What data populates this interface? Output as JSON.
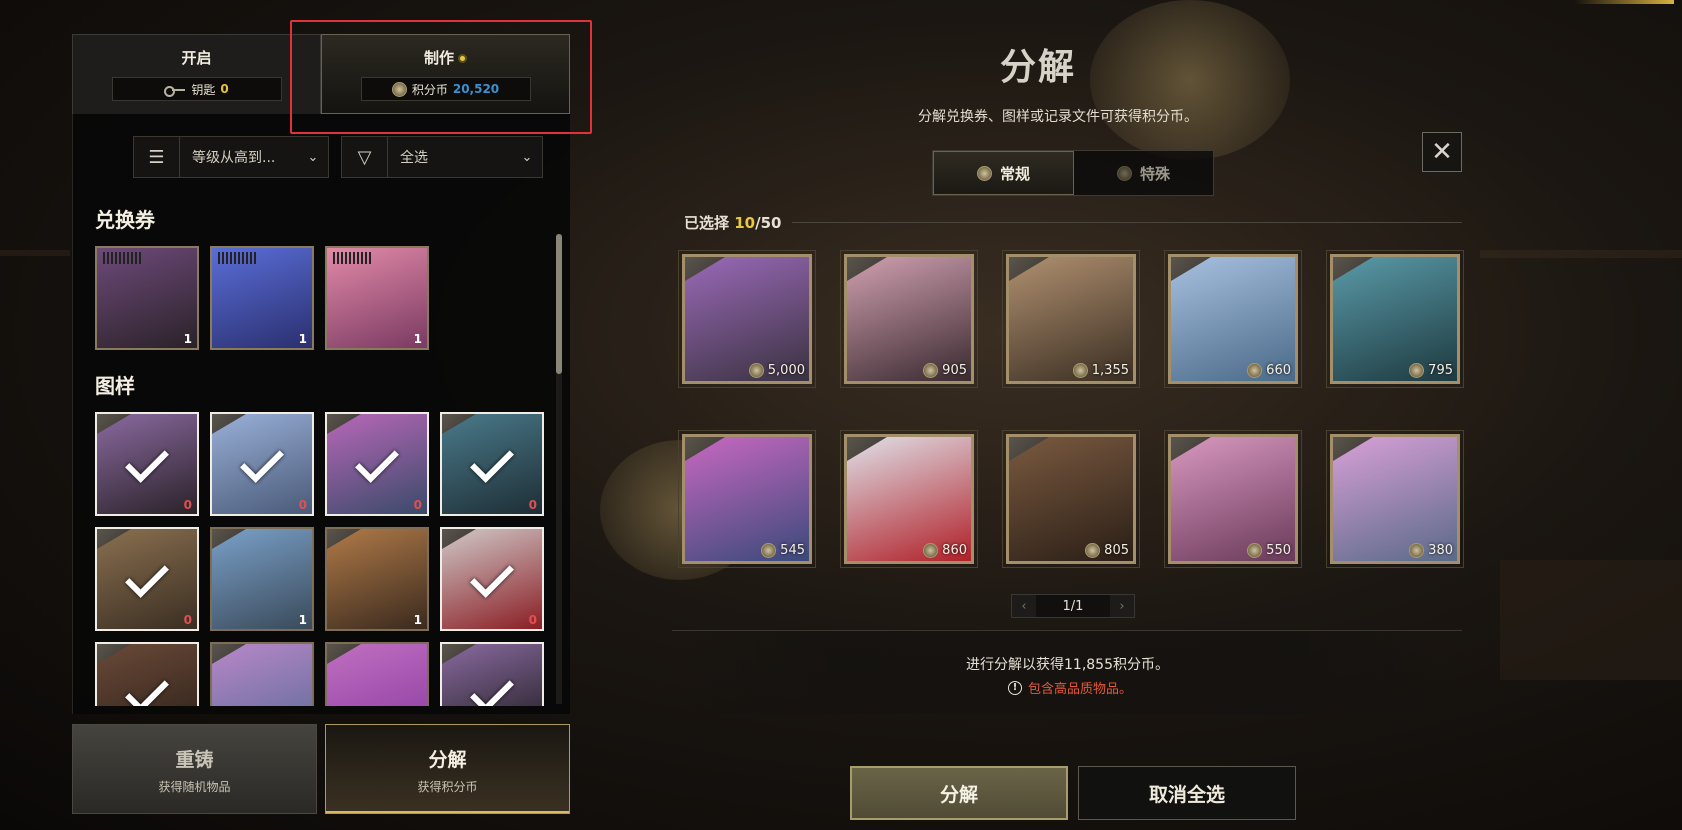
{
  "tabs": {
    "open": {
      "label": "开启",
      "counter_label": "钥匙",
      "counter_value": "0"
    },
    "craft": {
      "label": "制作",
      "counter_label": "积分币",
      "counter_value": "20,520"
    }
  },
  "filters": {
    "sort_label": "等级从高到...",
    "filter_label": "全选"
  },
  "sections": {
    "vouchers_title": "兑换券",
    "patterns_title": "图样"
  },
  "vouchers": [
    {
      "qty": "1",
      "colors": [
        "#6e4a7a",
        "#2a2228"
      ]
    },
    {
      "qty": "1",
      "colors": [
        "#5a6ed8",
        "#2a2f6e"
      ]
    },
    {
      "qty": "1",
      "colors": [
        "#e28aa8",
        "#7a3a62"
      ]
    }
  ],
  "patterns": [
    {
      "qty": "0",
      "selected": true,
      "colors": [
        "#8a6aa0",
        "#2a2228"
      ]
    },
    {
      "qty": "0",
      "selected": true,
      "colors": [
        "#9ab0d8",
        "#4a5a78"
      ]
    },
    {
      "qty": "0",
      "selected": true,
      "colors": [
        "#b868b8",
        "#3a4a6a"
      ]
    },
    {
      "qty": "0",
      "selected": true,
      "colors": [
        "#4a7a8a",
        "#1e2e36"
      ]
    },
    {
      "qty": "0",
      "selected": true,
      "colors": [
        "#8a7050",
        "#3a2e22"
      ]
    },
    {
      "qty": "1",
      "selected": false,
      "colors": [
        "#7aa0c8",
        "#3a4a5a"
      ]
    },
    {
      "qty": "1",
      "selected": false,
      "colors": [
        "#b07a48",
        "#3a2a1e"
      ]
    },
    {
      "qty": "0",
      "selected": true,
      "colors": [
        "#d0c8c8",
        "#8a1e24"
      ]
    },
    {
      "qty": "",
      "selected": true,
      "colors": [
        "#6a4a38",
        "#2a1e18"
      ]
    },
    {
      "qty": "",
      "selected": false,
      "colors": [
        "#b888c8",
        "#5a6a98"
      ]
    },
    {
      "qty": "",
      "selected": false,
      "colors": [
        "#c070c0",
        "#8a3aa0"
      ]
    },
    {
      "qty": "",
      "selected": true,
      "colors": [
        "#8a6aa0",
        "#1a1a1a"
      ]
    }
  ],
  "bottom_tabs": {
    "reforge": {
      "title": "重铸",
      "sub": "获得随机物品"
    },
    "decompose": {
      "title": "分解",
      "sub": "获得积分币"
    }
  },
  "main": {
    "title": "分解",
    "subtitle": "分解兑换券、图样或记录文件可获得积分币。",
    "mode_normal": "常规",
    "mode_special": "特殊",
    "selected_prefix": "已选择",
    "selected_count": "10",
    "selected_total": "/50",
    "page": "1/1",
    "summary": "进行分解以获得11,855积分币。",
    "warning": "包含高品质物品。",
    "decompose_btn": "分解",
    "deselect_btn": "取消全选"
  },
  "selected_items": [
    {
      "value": "5,000",
      "colors": [
        "#9a6ab8",
        "#3a3240"
      ]
    },
    {
      "value": "905",
      "colors": [
        "#d0a0b0",
        "#3a2a30"
      ]
    },
    {
      "value": "1,355",
      "colors": [
        "#b09070",
        "#3a2e22"
      ]
    },
    {
      "value": "660",
      "colors": [
        "#a8c0e0",
        "#4a6a88"
      ]
    },
    {
      "value": "795",
      "colors": [
        "#5a9aa8",
        "#1e3a40"
      ]
    },
    {
      "value": "545",
      "colors": [
        "#c868c0",
        "#3a4a7a"
      ]
    },
    {
      "value": "860",
      "colors": [
        "#e0e0e8",
        "#b02028"
      ]
    },
    {
      "value": "805",
      "colors": [
        "#7a5a40",
        "#2a1e16"
      ]
    },
    {
      "value": "550",
      "colors": [
        "#d898c0",
        "#6a3a5a"
      ]
    },
    {
      "value": "380",
      "colors": [
        "#d8a0d8",
        "#5a6a88"
      ]
    }
  ]
}
